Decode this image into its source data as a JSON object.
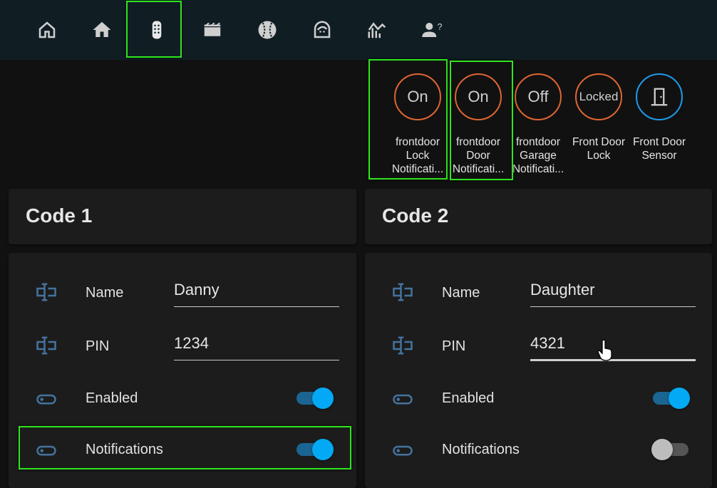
{
  "colors": {
    "accent": "#03a9f4",
    "state_on": "#df6532",
    "sensor": "#1e9be9",
    "highlight": "#2ee51e"
  },
  "tabs": [
    {
      "name": "home-outline",
      "icon": "home-outline-icon"
    },
    {
      "name": "home",
      "icon": "home-icon"
    },
    {
      "name": "remote",
      "icon": "remote-icon",
      "selected": true
    },
    {
      "name": "movie",
      "icon": "clapperboard-icon"
    },
    {
      "name": "baseball",
      "icon": "baseball-icon"
    },
    {
      "name": "face-woman",
      "icon": "face-woman-icon"
    },
    {
      "name": "chart",
      "icon": "chart-line-icon"
    },
    {
      "name": "account-question",
      "icon": "account-question-icon"
    }
  ],
  "badges": [
    {
      "state": "On",
      "label": [
        "frontdoor",
        "Lock",
        "Notificati..."
      ]
    },
    {
      "state": "On",
      "label": [
        "frontdoor",
        "Door",
        "Notificati..."
      ]
    },
    {
      "state": "Off",
      "label": [
        "frontdoor",
        "Garage",
        "Notificati..."
      ]
    },
    {
      "state": "Locked",
      "label": [
        "Front Door",
        "Lock",
        ""
      ]
    },
    {
      "state": "",
      "icon": "door-icon",
      "label": [
        "Front Door",
        "Sensor",
        ""
      ]
    }
  ],
  "cards": [
    {
      "title": "Code 1",
      "name_label": "Name",
      "name_value": "Danny",
      "pin_label": "PIN",
      "pin_value": "1234",
      "enabled_label": "Enabled",
      "enabled": true,
      "notifications_label": "Notifications",
      "notifications": true
    },
    {
      "title": "Code 2",
      "name_label": "Name",
      "name_value": "Daughter",
      "pin_label": "PIN",
      "pin_value": "4321",
      "enabled_label": "Enabled",
      "enabled": true,
      "notifications_label": "Notifications",
      "notifications": false
    }
  ]
}
